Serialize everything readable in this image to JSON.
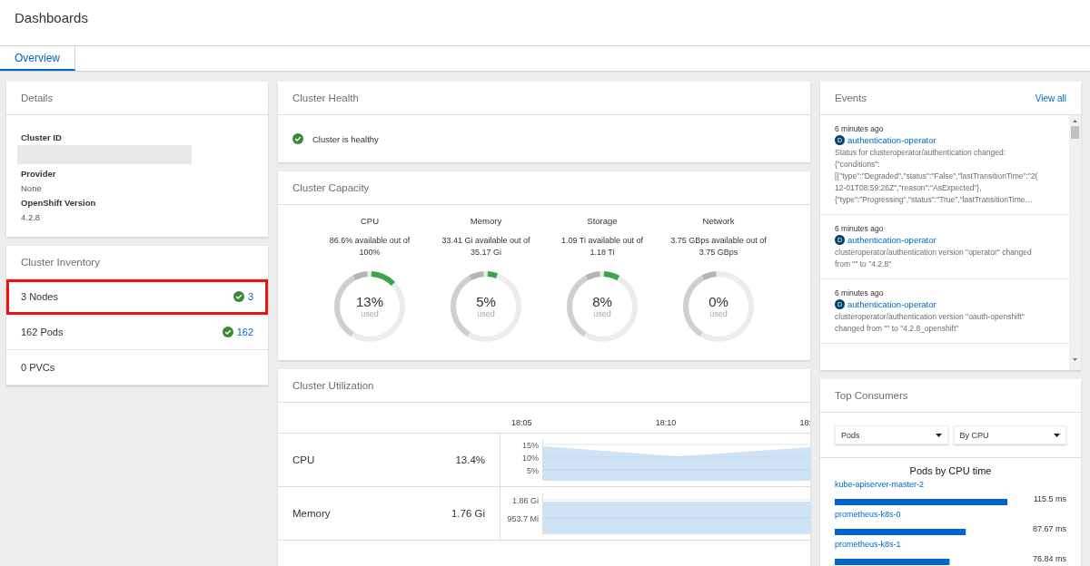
{
  "page": {
    "title": "Dashboards"
  },
  "tabs": [
    {
      "label": "Overview",
      "selected": true
    }
  ],
  "details": {
    "title": "Details",
    "fields": [
      {
        "label": "Cluster ID",
        "redacted": true
      },
      {
        "label": "Provider",
        "value": "None"
      },
      {
        "label": "OpenShift Version",
        "value": "4.2.8"
      }
    ]
  },
  "inventory": {
    "title": "Cluster Inventory",
    "items": [
      {
        "label": "3 Nodes",
        "count": "3",
        "highlighted": true
      },
      {
        "label": "162 Pods",
        "count": "162",
        "highlighted": false
      },
      {
        "label": "0 PVCs",
        "highlighted": false
      }
    ]
  },
  "health": {
    "title": "Cluster Health",
    "message": "Cluster is healthy"
  },
  "capacity": {
    "title": "Cluster Capacity",
    "gauges": [
      {
        "name": "CPU",
        "summary": "86.6% available out of 100%",
        "percent": "13%",
        "unit": "used"
      },
      {
        "name": "Memory",
        "summary": "33.41 Gi available out of 35.17 Gi",
        "percent": "5%",
        "unit": "used"
      },
      {
        "name": "Storage",
        "summary": "1.09 Ti available out of 1.18 Ti",
        "percent": "8%",
        "unit": "used"
      },
      {
        "name": "Network",
        "summary": "3.75 GBps available out of 3.75 GBps",
        "percent": "0%",
        "unit": "used"
      }
    ]
  },
  "utilization": {
    "title": "Cluster Utilization",
    "time_labels": [
      "18:05",
      "18:10",
      "18:"
    ],
    "rows": [
      {
        "name": "CPU",
        "value": "13.4%",
        "y_labels": [
          "15%",
          "10%",
          "5%"
        ]
      },
      {
        "name": "Memory",
        "value": "1.76 Gi",
        "y_labels": [
          "1.86 Gi",
          "953.7 Mi"
        ]
      }
    ]
  },
  "events": {
    "title": "Events",
    "link": "View all",
    "items": [
      {
        "time": "6 minutes ago",
        "badge": "D",
        "source": "authentication-operator",
        "message_lines": [
          "Status for clusteroperator/authentication changed:",
          "{\"conditions\":",
          "[{\"type\":\"Degraded\",\"status\":\"False\",\"lastTransitionTime\":\"2(",
          "12-01T08:59:26Z\",\"reason\":\"AsExpected\"},",
          "{\"type\":\"Progressing\",\"status\":\"True\",\"lastTransitionTime…"
        ]
      },
      {
        "time": "6 minutes ago",
        "badge": "D",
        "source": "authentication-operator",
        "message_lines": [
          "clusteroperator/authentication version \"operator\" changed",
          "from \"\" to \"4.2.8\""
        ]
      },
      {
        "time": "6 minutes ago",
        "badge": "D",
        "source": "authentication-operator",
        "message_lines": [
          "clusteroperator/authentication version \"oauth-openshift\"",
          "changed from \"\" to \"4.2.8_openshift\""
        ]
      }
    ]
  },
  "consumers": {
    "title": "Top Consumers",
    "selects": [
      {
        "value": "Pods"
      },
      {
        "value": "By CPU"
      }
    ],
    "chart_data": {
      "type": "bar",
      "orientation": "horizontal",
      "title": "Pods by CPU time",
      "categories": [
        "kube-apiserver-master-2",
        "prometheus-k8s-0",
        "prometheus-k8s-1"
      ],
      "values": [
        115.5,
        87.67,
        76.84
      ],
      "value_labels": [
        "115.5 ms",
        "87.67 ms",
        "76.84 ms"
      ]
    }
  }
}
